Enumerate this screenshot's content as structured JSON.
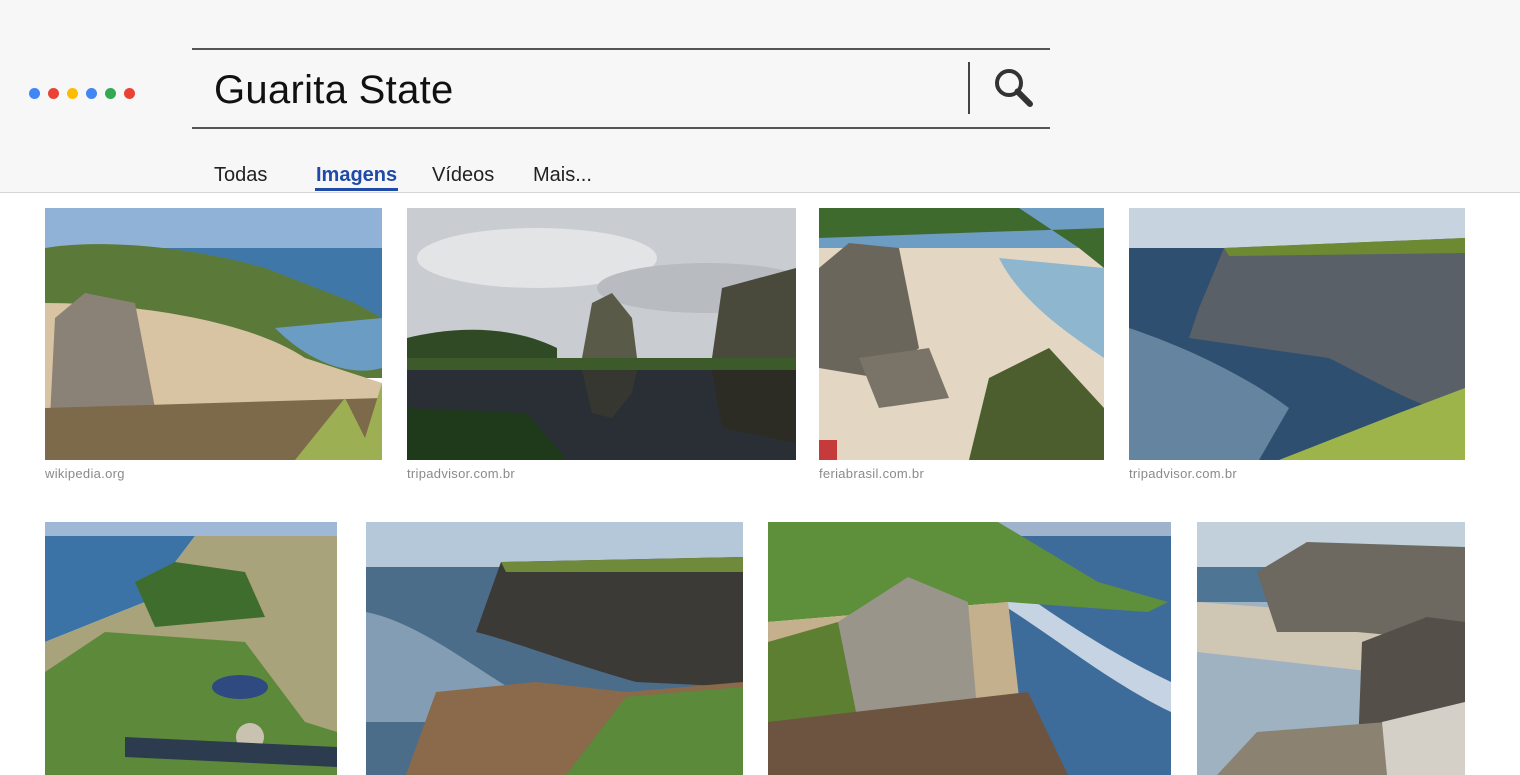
{
  "logo": {
    "name": "google-dots-logo",
    "colors": [
      "#4285f4",
      "#ea4335",
      "#fbbc05",
      "#4285f4",
      "#34a853",
      "#ea4335"
    ]
  },
  "search": {
    "query": "Guarita State",
    "button_icon": "search-icon"
  },
  "tabs": [
    {
      "label": "Todas",
      "active": false
    },
    {
      "label": "Imagens",
      "active": true
    },
    {
      "label": "Vídeos",
      "active": false
    },
    {
      "label": "Mais...",
      "active": false
    }
  ],
  "accent_color": "#1f4aa8",
  "results": [
    {
      "source": "wikipedia.org"
    },
    {
      "source": "tripadvisor.com.br"
    },
    {
      "source": "feriabrasil.com.br"
    },
    {
      "source": "tripadvisor.com.br"
    },
    {
      "source": ""
    },
    {
      "source": ""
    },
    {
      "source": ""
    },
    {
      "source": ""
    }
  ]
}
